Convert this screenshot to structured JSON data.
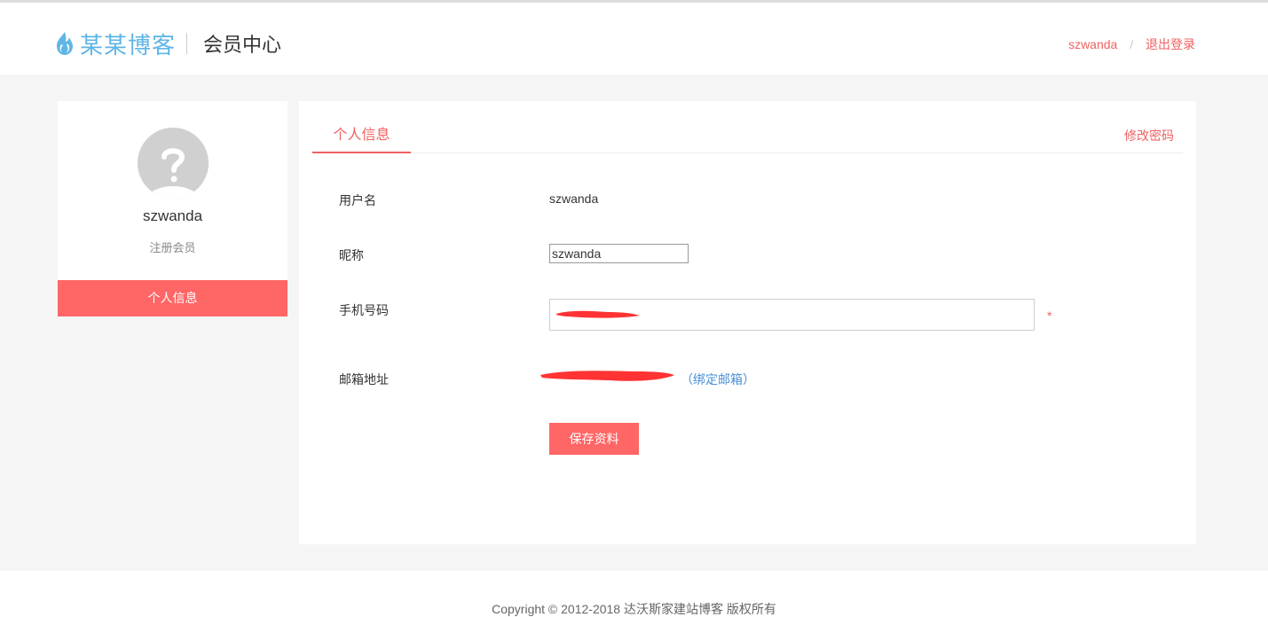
{
  "header": {
    "logo_text": "某某博客",
    "section_title": "会员中心",
    "username_link": "szwanda",
    "separator": "/",
    "logout_link": "退出登录"
  },
  "sidebar": {
    "username": "szwanda",
    "role": "注册会员",
    "menu_item": "个人信息"
  },
  "main": {
    "tab_active": "个人信息",
    "tab_link": "修改密码",
    "fields": {
      "username_label": "用户名",
      "username_value": "szwanda",
      "nickname_label": "昵称",
      "nickname_value": "szwanda",
      "phone_label": "手机号码",
      "phone_required": "*",
      "email_label": "邮箱地址",
      "email_bind_link": "（绑定邮箱）"
    },
    "save_button": "保存资料"
  },
  "footer": {
    "copyright": "Copyright © 2012-2018 达沃斯家建站博客 版权所有"
  },
  "colors": {
    "accent": "#ff6666",
    "accent_text": "#f06060",
    "logo_blue": "#5fb6e6",
    "link_blue": "#4a90d9",
    "redaction": "#ff3333"
  },
  "icons": {
    "logo": "flame-icon",
    "avatar": "question-avatar-icon"
  }
}
